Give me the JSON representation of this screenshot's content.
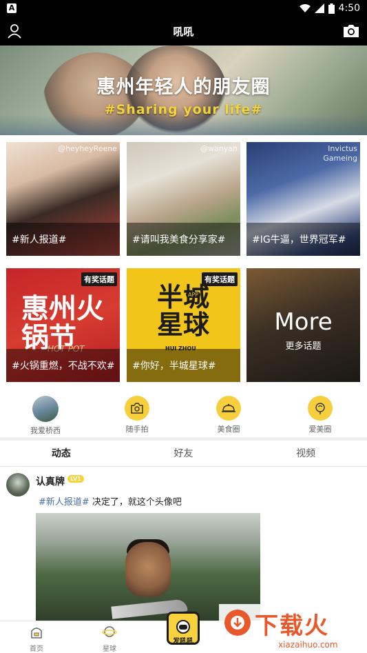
{
  "status_bar": {
    "left_glyph": "A",
    "time": "4:50"
  },
  "app_bar": {
    "title": "吼吼"
  },
  "banner": {
    "title": "惠州年轻人的朋友圈",
    "subtitle": "#Sharing your life#"
  },
  "topics": [
    {
      "caption": "#新人报道#",
      "credit": "@heyheyReene",
      "badge": ""
    },
    {
      "caption": "#请叫我美食分享家#",
      "credit": "@wanyan",
      "badge": ""
    },
    {
      "caption": "#IG牛逼，世界冠军#",
      "credit": "Invictus Gameing",
      "badge": ""
    },
    {
      "caption": "#火锅重燃，不战不欢#",
      "credit": "",
      "badge": "有奖话题",
      "art_text": "惠州火锅节",
      "art_sub": "HOT POT"
    },
    {
      "caption": "#你好，半城星球#",
      "credit": "",
      "badge": "有奖话题",
      "art_text": "半城星球",
      "art_app": "APP",
      "art_sub": "HUI ZHOU"
    },
    {
      "caption": "",
      "credit": "",
      "badge": "",
      "more_title": "More",
      "more_sub": "更多话题"
    }
  ],
  "quick_links": [
    {
      "label": "我爱桥西",
      "icon": "city-photo-icon"
    },
    {
      "label": "随手拍",
      "icon": "camera-icon"
    },
    {
      "label": "美食圈",
      "icon": "food-cloche-icon"
    },
    {
      "label": "爱美圈",
      "icon": "mirror-icon"
    }
  ],
  "feed_tabs": [
    {
      "label": "动态",
      "active": true
    },
    {
      "label": "好友",
      "active": false
    },
    {
      "label": "视频",
      "active": false
    }
  ],
  "post": {
    "author": "认真牌",
    "level": "LV1",
    "tag": "#新人报道#",
    "text": " 决定了，就这个头像吧"
  },
  "bottom_nav": [
    {
      "label": "首页",
      "icon": "home-icon"
    },
    {
      "label": "星球",
      "icon": "planet-icon"
    },
    {
      "label": "发吼吼",
      "icon": "astronaut-icon"
    }
  ],
  "watermark": {
    "cn": "下载火",
    "en": "xiazaihuo.com"
  },
  "colors": {
    "accent": "#f7d23c",
    "bar": "#000000",
    "watermark": "#e9582b"
  }
}
